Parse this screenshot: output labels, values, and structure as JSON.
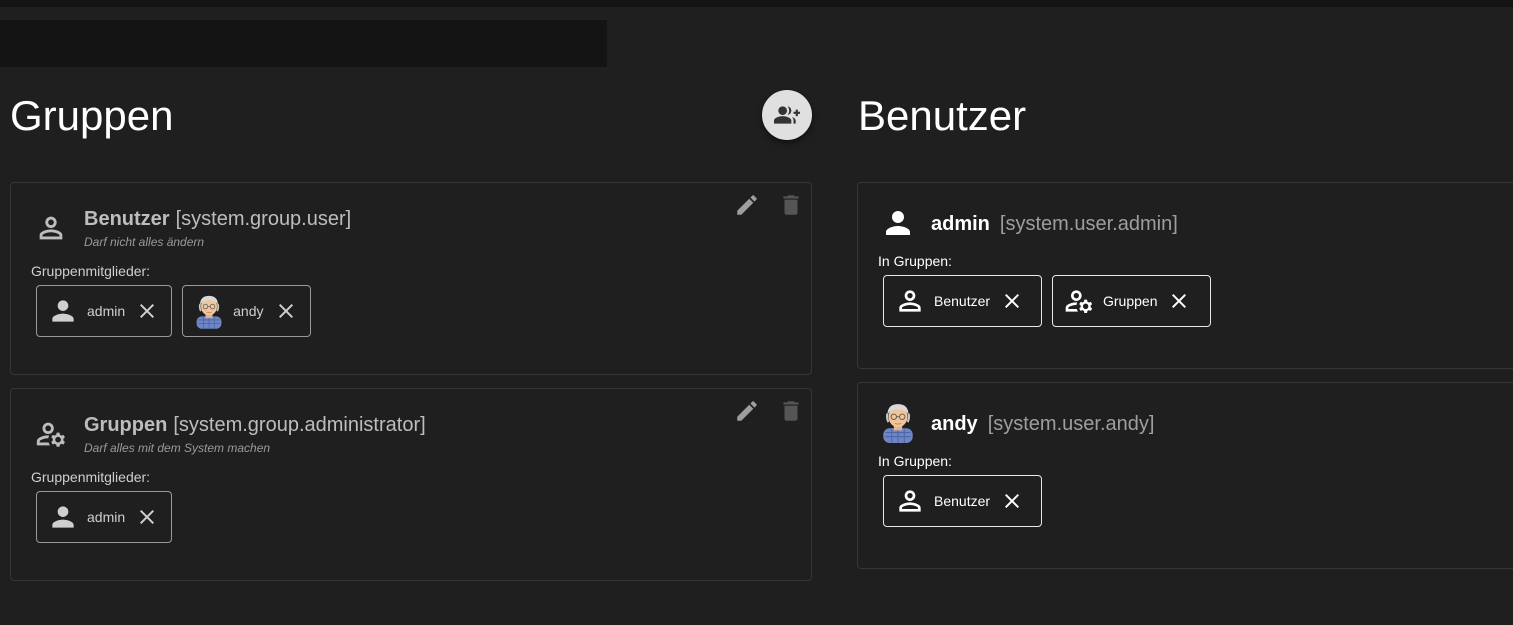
{
  "groups_panel": {
    "title": "Gruppen",
    "add_button_icon": "group-add-icon",
    "cards": [
      {
        "name": "Benutzer",
        "ident": "[system.group.user]",
        "description": "Darf nicht alles ändern",
        "icon": "person-outline-icon",
        "members_label": "Gruppenmitglieder:",
        "members": [
          {
            "label": "admin",
            "icon": "person-icon"
          },
          {
            "label": "andy",
            "icon": "avatar-andy"
          }
        ]
      },
      {
        "name": "Gruppen",
        "ident": "[system.group.administrator]",
        "description": "Darf alles mit dem System machen",
        "icon": "manage-accounts-icon",
        "members_label": "Gruppenmitglieder:",
        "members": [
          {
            "label": "admin",
            "icon": "person-icon"
          }
        ]
      }
    ]
  },
  "users_panel": {
    "title": "Benutzer",
    "cards": [
      {
        "name": "admin",
        "ident": "[system.user.admin]",
        "icon": "person-icon",
        "groups_label": "In Gruppen:",
        "groups": [
          {
            "label": "Benutzer",
            "icon": "person-outline-icon"
          },
          {
            "label": "Gruppen",
            "icon": "manage-accounts-icon"
          }
        ]
      },
      {
        "name": "andy",
        "ident": "[system.user.andy]",
        "icon": "avatar-andy",
        "groups_label": "In Gruppen:",
        "groups": [
          {
            "label": "Benutzer",
            "icon": "person-outline-icon"
          }
        ]
      }
    ]
  },
  "colors": {
    "background": "#1f1f1f",
    "card_border": "#363636",
    "fab": "#e0e0e0"
  }
}
